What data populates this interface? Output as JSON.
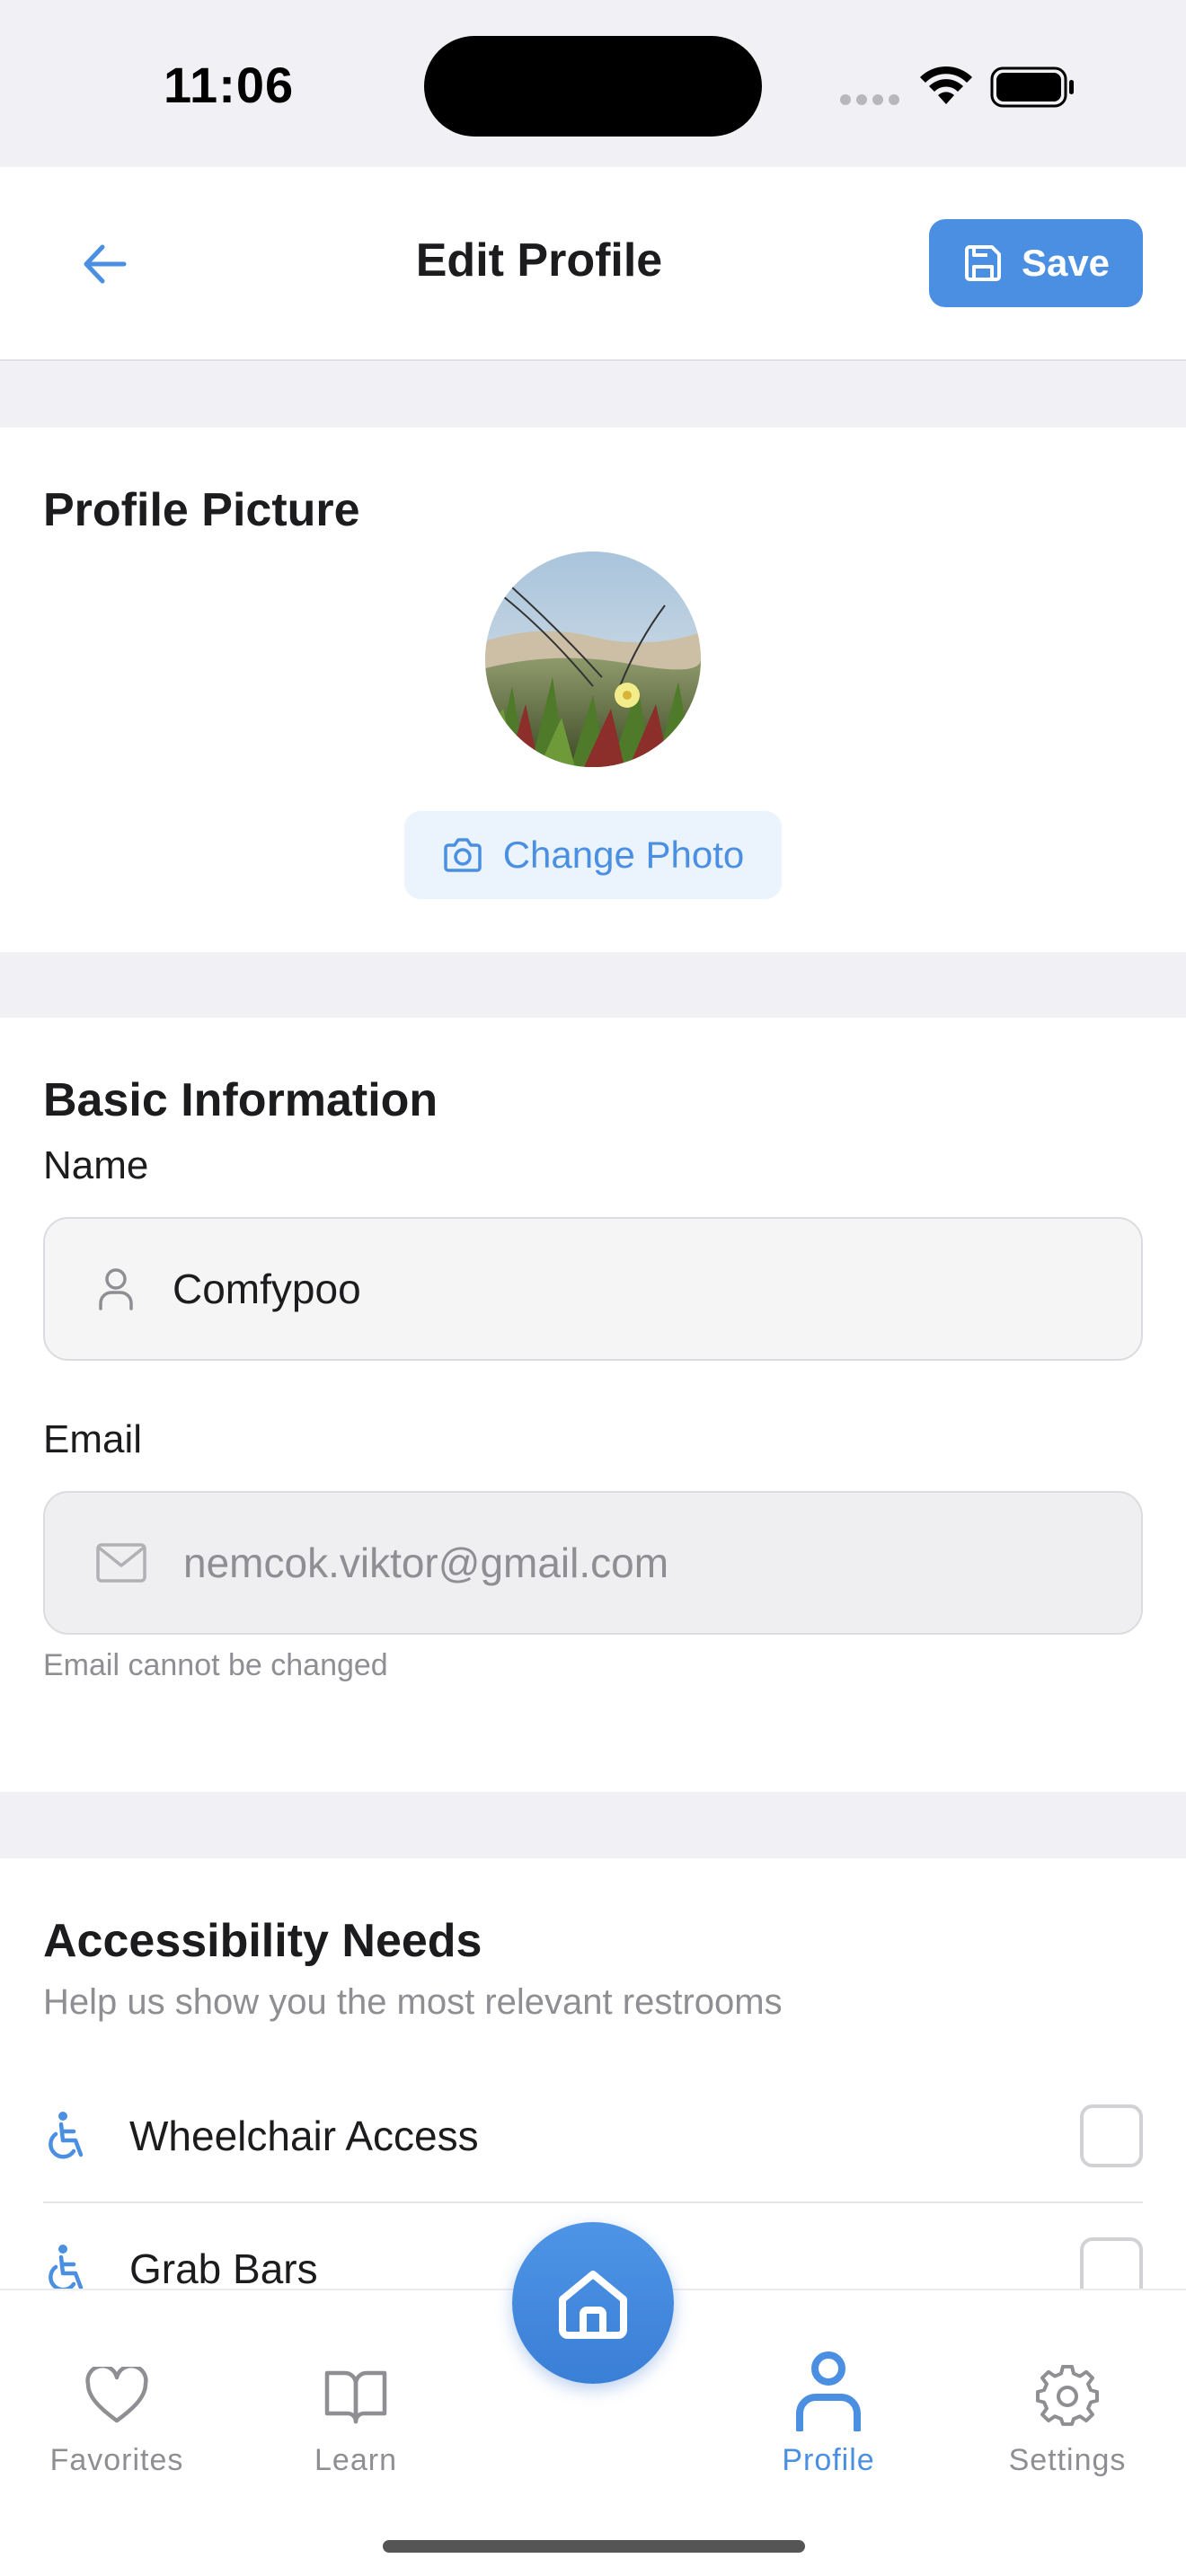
{
  "status_bar": {
    "time": "11:06"
  },
  "header": {
    "title": "Edit Profile",
    "save_label": "Save"
  },
  "profile_picture": {
    "title": "Profile Picture",
    "change_photo_label": "Change Photo"
  },
  "basic_info": {
    "title": "Basic Information",
    "name_label": "Name",
    "name_value": "Comfypoo",
    "email_label": "Email",
    "email_value": "nemcok.viktor@gmail.com",
    "email_hint": "Email cannot be changed"
  },
  "accessibility": {
    "title": "Accessibility Needs",
    "subtitle": "Help us show you the most relevant restrooms",
    "items": [
      {
        "label": "Wheelchair Access",
        "icon": "wheelchair-icon",
        "checked": false
      },
      {
        "label": "Grab Bars",
        "icon": "grab-bars-icon",
        "checked": false
      }
    ]
  },
  "tab_bar": {
    "tabs": [
      {
        "label": "Favorites",
        "icon": "heart-icon",
        "active": false
      },
      {
        "label": "Learn",
        "icon": "book-icon",
        "active": false
      },
      {
        "label": "Profile",
        "icon": "person-icon",
        "active": true
      },
      {
        "label": "Settings",
        "icon": "gear-icon",
        "active": false
      }
    ],
    "center_button_icon": "home-icon"
  },
  "colors": {
    "accent": "#4a8fe2",
    "background": "#f1f1f5",
    "muted_text": "#8e8e93"
  }
}
